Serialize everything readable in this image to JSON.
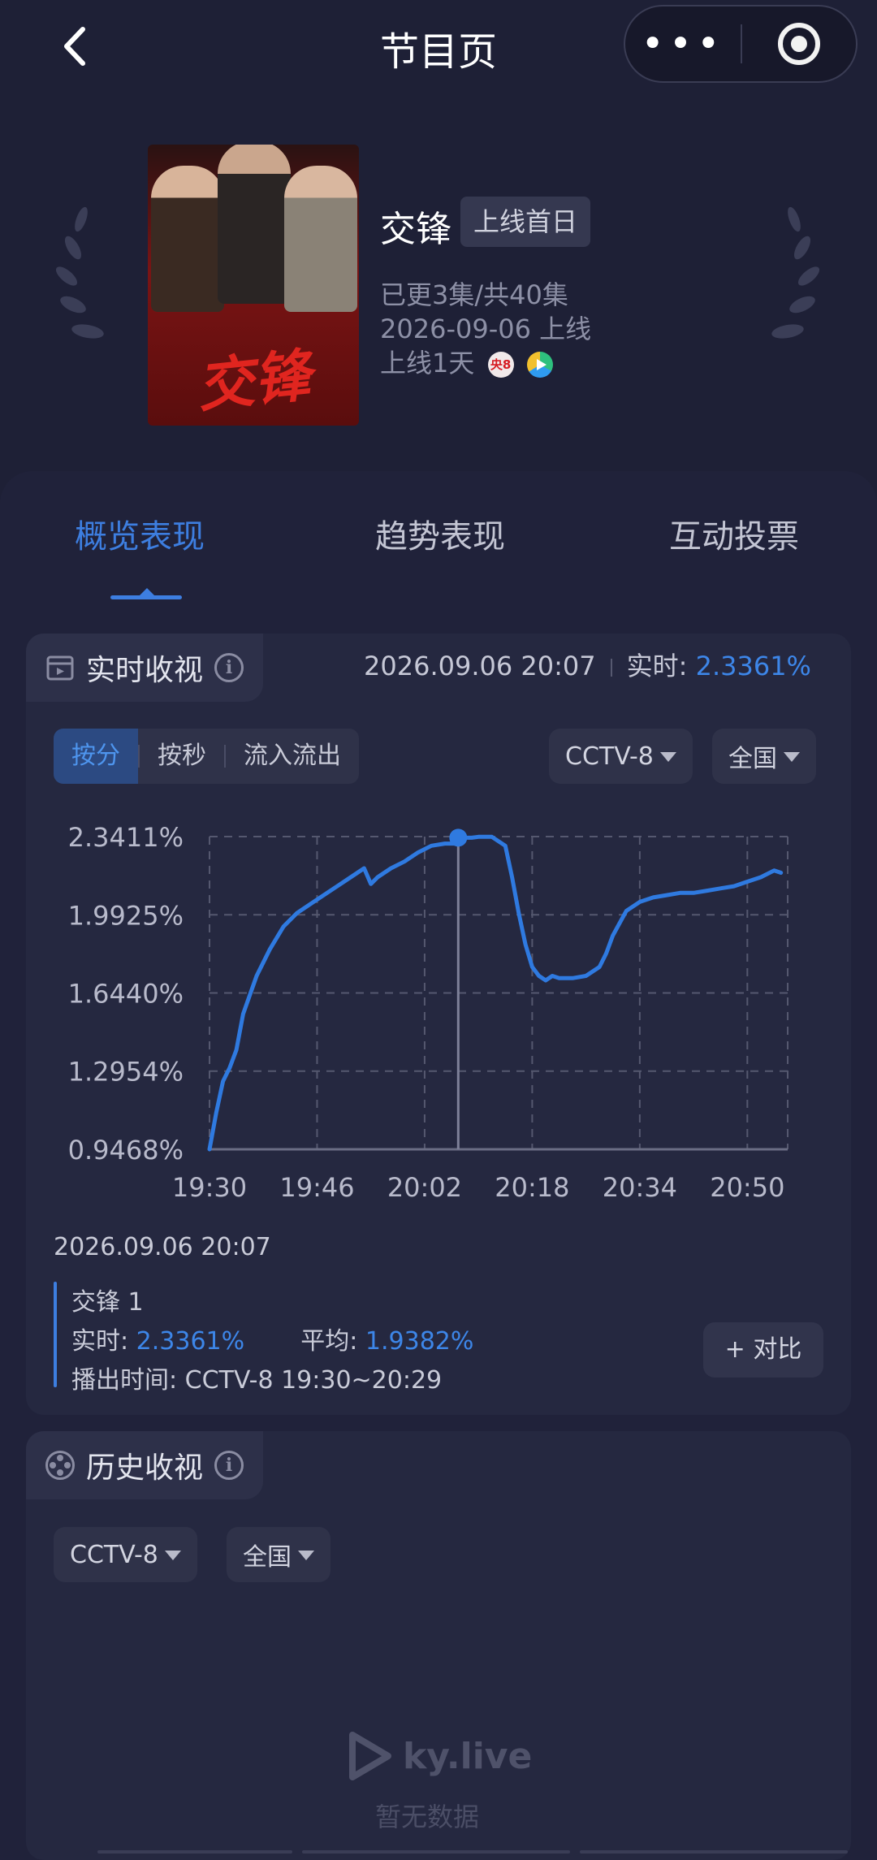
{
  "nav": {
    "title": "节目页",
    "more_icon": "•••"
  },
  "show": {
    "name": "交锋",
    "badge": "上线首日",
    "episodes": "已更3集/共40集",
    "launch_date": "2026-09-06 上线",
    "days_online": "上线1天",
    "poster_title": "交锋",
    "channel_icon_label": "央8"
  },
  "tabs": [
    {
      "label": "概览表现",
      "active": true
    },
    {
      "label": "趋势表现",
      "active": false
    },
    {
      "label": "互动投票",
      "active": false
    }
  ],
  "realtime": {
    "title": "实时收视",
    "timestamp": "2026.09.06 20:07",
    "live_label": "实时:",
    "live_value": "2.3361%",
    "segments": [
      "按分",
      "按秒",
      "流入流出"
    ],
    "active_segment": "按分",
    "channel_select": "CCTV-8",
    "region_select": "全国"
  },
  "chart_data": {
    "type": "line",
    "title": "",
    "xlabel": "",
    "ylabel": "",
    "x_ticks": [
      "19:30",
      "19:46",
      "20:02",
      "20:18",
      "20:34",
      "20:50"
    ],
    "y_ticks": [
      "2.3411%",
      "1.9925%",
      "1.6440%",
      "1.2954%",
      "0.9468%"
    ],
    "ylim": [
      0.9468,
      2.3411
    ],
    "xlim_minutes": [
      0,
      86
    ],
    "grid": true,
    "highlight": {
      "x": "20:07",
      "y": 2.3361
    },
    "series": [
      {
        "color": "#2f7ae0",
        "x": [
          0,
          1,
          2,
          3,
          4,
          5,
          7,
          9,
          11,
          13,
          15,
          17,
          19,
          21,
          23,
          24,
          25,
          27,
          29,
          31,
          33,
          35,
          37,
          38,
          39,
          40,
          42,
          44,
          45,
          46,
          47,
          48,
          49,
          50,
          51,
          52,
          53,
          54,
          56,
          58,
          59,
          60,
          62,
          64,
          66,
          68,
          70,
          72,
          74,
          76,
          78,
          80,
          82,
          84,
          85
        ],
        "y": [
          0.9468,
          1.11,
          1.25,
          1.31,
          1.39,
          1.55,
          1.72,
          1.84,
          1.94,
          2.0,
          2.04,
          2.08,
          2.12,
          2.16,
          2.2,
          2.13,
          2.16,
          2.2,
          2.23,
          2.27,
          2.3,
          2.31,
          2.31,
          2.3361,
          2.3361,
          2.34,
          2.34,
          2.3,
          2.16,
          2.0,
          1.86,
          1.76,
          1.72,
          1.7,
          1.72,
          1.71,
          1.71,
          1.71,
          1.72,
          1.76,
          1.82,
          1.9,
          2.01,
          2.05,
          2.07,
          2.08,
          2.09,
          2.09,
          2.1,
          2.11,
          2.12,
          2.14,
          2.16,
          2.19,
          2.18
        ]
      }
    ]
  },
  "detail": {
    "date": "2026.09.06 20:07",
    "program": "交锋 1",
    "live_label": "实时:",
    "live_value": "2.3361%",
    "avg_label": "平均:",
    "avg_value": "1.9382%",
    "air_time_label": "播出时间:",
    "air_time_value": "CCTV-8 19:30~20:29",
    "compare_button": "+ 对比"
  },
  "history": {
    "title": "历史收视",
    "channel_select": "CCTV-8",
    "region_select": "全国"
  },
  "watermark": {
    "brand": "ky.live",
    "sub": "暂无数据"
  }
}
